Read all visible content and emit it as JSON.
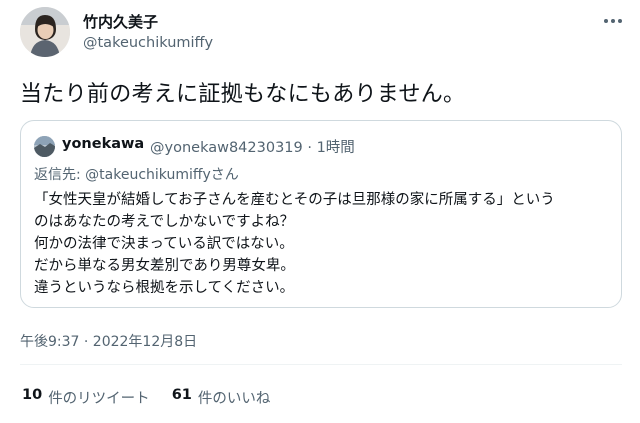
{
  "tweet": {
    "author_name": "竹内久美子",
    "author_handle": "@takeuchikumiffy",
    "text": "当たり前の考えに証拠もなにもありません。",
    "timestamp": "午後9:37 · 2022年12月8日"
  },
  "quote": {
    "name": "yonekawa",
    "handle_time": "@yonekaw84230319 · 1時間",
    "reply_prefix": "返信先: ",
    "reply_mention": "@takeuchikumiffyさん",
    "lines": [
      "「女性天皇が結婚してお子さんを産むとその子は旦那様の家に所属する」という",
      "のはあなたの考えでしかないですよね？",
      "何かの法律で決まっている訳ではない。",
      "だから単なる男女差別であり男尊女卑。",
      "違うというなら根拠を示してください。"
    ]
  },
  "stats": {
    "retweets_count": "10",
    "retweets_label": "件のリツイート",
    "likes_count": "61",
    "likes_label": "件のいいね"
  }
}
